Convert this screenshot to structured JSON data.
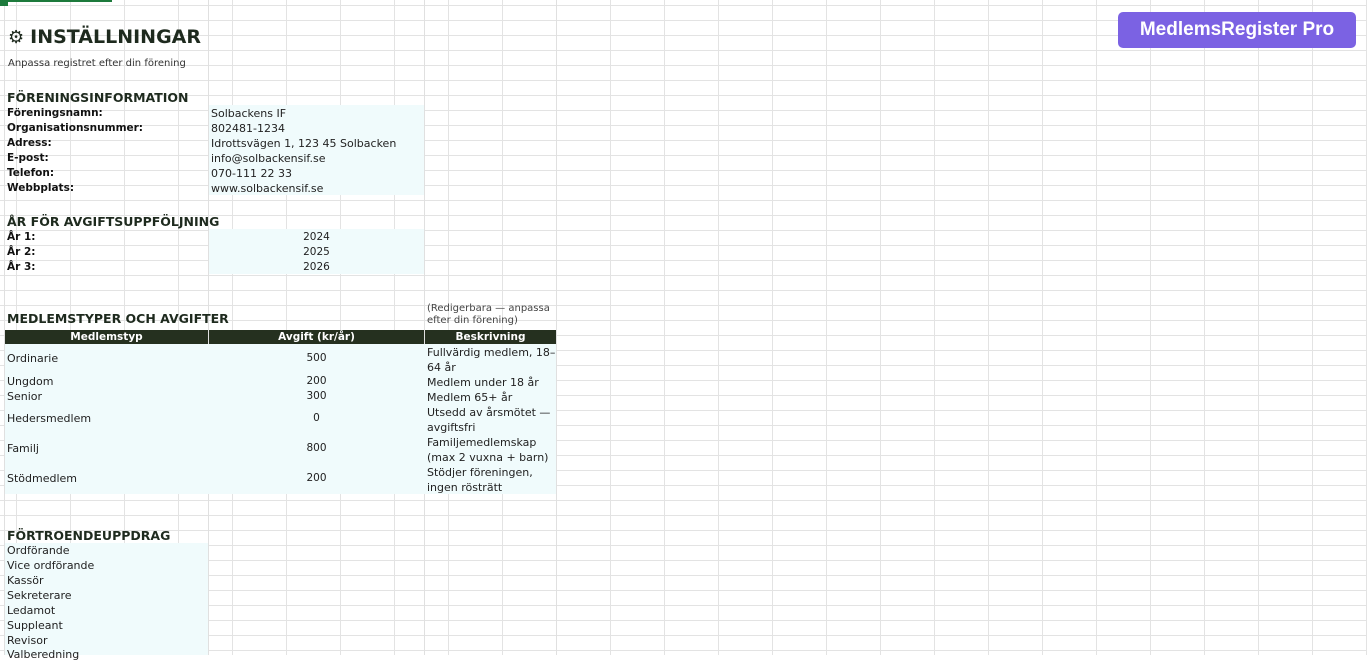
{
  "header": {
    "title": "INSTÄLLNINGAR",
    "subtitle": "Anpassa registret efter din förening",
    "gear_glyph": "⚙"
  },
  "brand": {
    "label": "MedlemsRegister Pro",
    "color": "#7b62e3"
  },
  "org": {
    "heading": "FÖRENINGSINFORMATION",
    "rows": [
      {
        "label": "Föreningsnamn:",
        "value": "Solbackens IF"
      },
      {
        "label": "Organisationsnummer:",
        "value": "802481-1234"
      },
      {
        "label": "Adress:",
        "value": "Idrottsvägen 1, 123 45 Solbacken"
      },
      {
        "label": "E-post:",
        "value": "info@solbackensif.se"
      },
      {
        "label": "Telefon:",
        "value": "070-111 22 33"
      },
      {
        "label": "Webbplats:",
        "value": "www.solbackensif.se"
      }
    ]
  },
  "years": {
    "heading": "ÅR FÖR AVGIFTSUPPFÖLJNING",
    "rows": [
      {
        "label": "År 1:",
        "value": "2024"
      },
      {
        "label": "År 2:",
        "value": "2025"
      },
      {
        "label": "År 3:",
        "value": "2026"
      }
    ]
  },
  "members": {
    "heading": "MEDLEMSTYPER OCH AVGIFTER",
    "note": "(Redigerbara — anpassa efter din förening)",
    "columns": [
      "Medlemstyp",
      "Avgift (kr/år)",
      "Beskrivning"
    ],
    "rows": [
      {
        "type": "Ordinarie",
        "fee": "500",
        "desc": "Fullvärdig medlem, 18–64 år"
      },
      {
        "type": "Ungdom",
        "fee": "200",
        "desc": "Medlem under 18 år"
      },
      {
        "type": "Senior",
        "fee": "300",
        "desc": "Medlem 65+ år"
      },
      {
        "type": "Hedersmedlem",
        "fee": "0",
        "desc": "Utsedd av årsmötet — avgiftsfri"
      },
      {
        "type": "Familj",
        "fee": "800",
        "desc": "Familjemedlemskap (max 2 vuxna + barn)"
      },
      {
        "type": "Stödmedlem",
        "fee": "200",
        "desc": "Stödjer föreningen, ingen rösträtt"
      }
    ],
    "header_color": "#25301f"
  },
  "roles": {
    "heading": "FÖRTROENDEUPPDRAG",
    "items": [
      "Ordförande",
      "Vice ordförande",
      "Kassör",
      "Sekreterare",
      "Ledamot",
      "Suppleant",
      "Revisor",
      "Valberedning"
    ]
  }
}
